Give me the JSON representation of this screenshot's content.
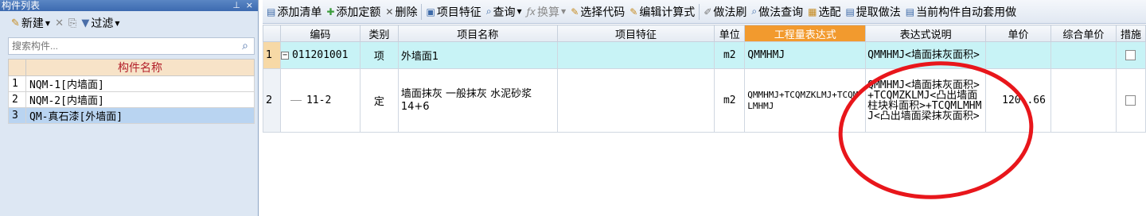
{
  "left_panel": {
    "title": "构件列表",
    "pin_glyph": "⊥",
    "close_glyph": "×",
    "toolbar": {
      "new_label": "新建",
      "delete_glyph": "✕",
      "filter_label": "过滤"
    },
    "search": {
      "placeholder": "搜索构件..."
    },
    "table": {
      "header": "构件名称",
      "rows": [
        {
          "num": "1",
          "name": "NQM-1[内墙面]"
        },
        {
          "num": "2",
          "name": "NQM-2[内墙面]"
        },
        {
          "num": "3",
          "name": "QM-真石漆[外墙面]"
        }
      ]
    }
  },
  "toolbar": {
    "add_list": "添加清单",
    "add_quota": "添加定额",
    "delete": "删除",
    "item_feature": "项目特征",
    "query": "查询",
    "convert": "换算",
    "select_code": "选择代码",
    "edit_formula": "编辑计算式",
    "method_brush": "做法刷",
    "method_query": "做法查询",
    "match": "选配",
    "extract_method": "提取做法",
    "auto_apply": "当前构件自动套用做"
  },
  "grid": {
    "headers": {
      "code": "编码",
      "type": "类别",
      "name": "项目名称",
      "feature": "项目特征",
      "unit": "单位",
      "expr": "工程量表达式",
      "expr_desc": "表达式说明",
      "price": "单价",
      "total": "综合单价",
      "measure": "措施"
    },
    "rows": [
      {
        "num": "1",
        "code": "011201001",
        "type": "项",
        "name": "外墙面1",
        "feature": "",
        "unit": "m2",
        "expr": "QMMHMJ",
        "expr_desc": "QMMHMJ<墙面抹灰面积>",
        "price": "",
        "total": ""
      },
      {
        "num": "2",
        "code": "11-2",
        "type": "定",
        "name": "墙面抹灰 一般抹灰 水泥砂浆 14+6",
        "feature": "",
        "unit": "m2",
        "expr": "QMMHMJ+TCQMZKLMJ+TCQMLMHMJ",
        "expr_desc": "QMMHMJ<墙面抹灰面积>+TCQMZKLMJ<凸出墙面柱块料面积>+TCQMLMHMJ<凸出墙面梁抹灰面积>",
        "price": "120..66",
        "total": ""
      }
    ]
  },
  "colors": {
    "highlight_header": "#f29a2e",
    "selected_row": "#c8f3f6",
    "annotation": "#e8161b"
  }
}
